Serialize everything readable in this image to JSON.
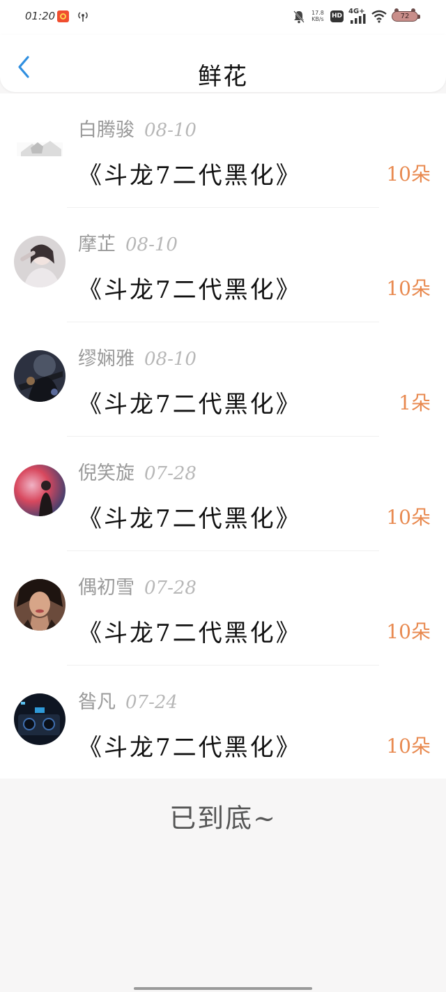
{
  "status_bar": {
    "time": "01:20",
    "net_speed": "17.8",
    "net_speed_unit": "KB/s",
    "hd_label": "HD",
    "network_type": "4G+",
    "battery": "72"
  },
  "header": {
    "title": "鲜花",
    "back_icon": "chevron-left-icon",
    "accent_color": "#2f8fe0"
  },
  "list": {
    "items": [
      {
        "name": "白腾骏",
        "date": "08-10",
        "book": "《斗龙7二代黑化》",
        "count": "10朵"
      },
      {
        "name": "摩芷",
        "date": "08-10",
        "book": "《斗龙7二代黑化》",
        "count": "10朵"
      },
      {
        "name": "缪娴雅",
        "date": "08-10",
        "book": "《斗龙7二代黑化》",
        "count": "1朵"
      },
      {
        "name": "倪笑旋",
        "date": "07-28",
        "book": "《斗龙7二代黑化》",
        "count": "10朵"
      },
      {
        "name": "偶初雪",
        "date": "07-28",
        "book": "《斗龙7二代黑化》",
        "count": "10朵"
      },
      {
        "name": "昝凡",
        "date": "07-24",
        "book": "《斗龙7二代黑化》",
        "count": "10朵"
      }
    ]
  },
  "footer": {
    "end_text": "已到底~"
  },
  "colors": {
    "count": "#e8894f",
    "name": "#9a9a9a",
    "background": "#f7f6f6"
  }
}
